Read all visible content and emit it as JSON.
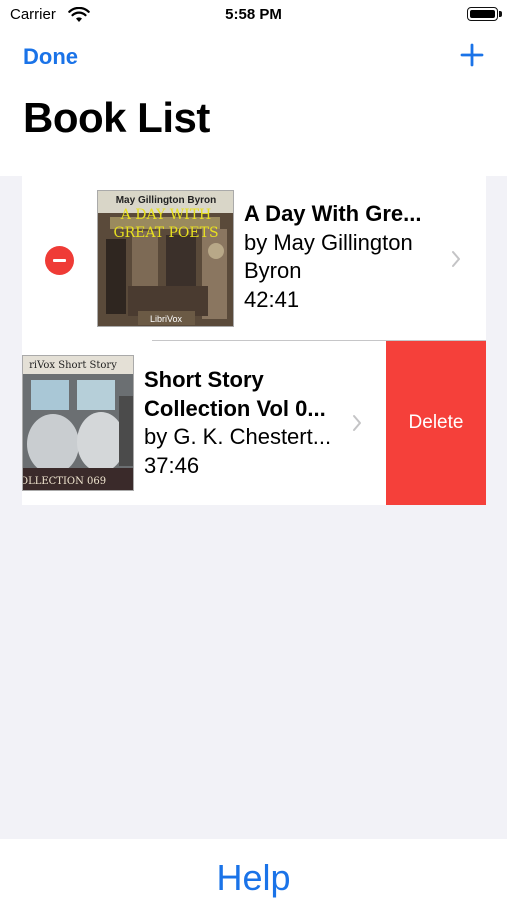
{
  "status_bar": {
    "carrier": "Carrier",
    "time": "5:58 PM"
  },
  "nav": {
    "done_label": "Done",
    "add_icon": "plus-icon",
    "title": "Book List"
  },
  "books": [
    {
      "cover_line1": "May Gillington Byron",
      "cover_line2": "A DAY WITH",
      "cover_line3": "GREAT POETS",
      "cover_badge": "LibriVox",
      "title": "A Day With Gre...",
      "author_line1": "by May Gillington",
      "author_line2": "Byron",
      "duration": "42:41",
      "edit_control": "minus-icon"
    },
    {
      "cover_line1": "riVox Short Story",
      "cover_line2": "OLLECTION 069",
      "title_line1": "Short Story",
      "title_line2": "Collection Vol 0...",
      "author": "by G. K. Chestert...",
      "duration": "37:46",
      "swipe_action": "Delete"
    }
  ],
  "footer": {
    "help_label": "Help"
  },
  "colors": {
    "accent": "#1a73e8",
    "delete": "#f5403a",
    "minus": "#ef3b36",
    "background": "#f2f2f7"
  }
}
